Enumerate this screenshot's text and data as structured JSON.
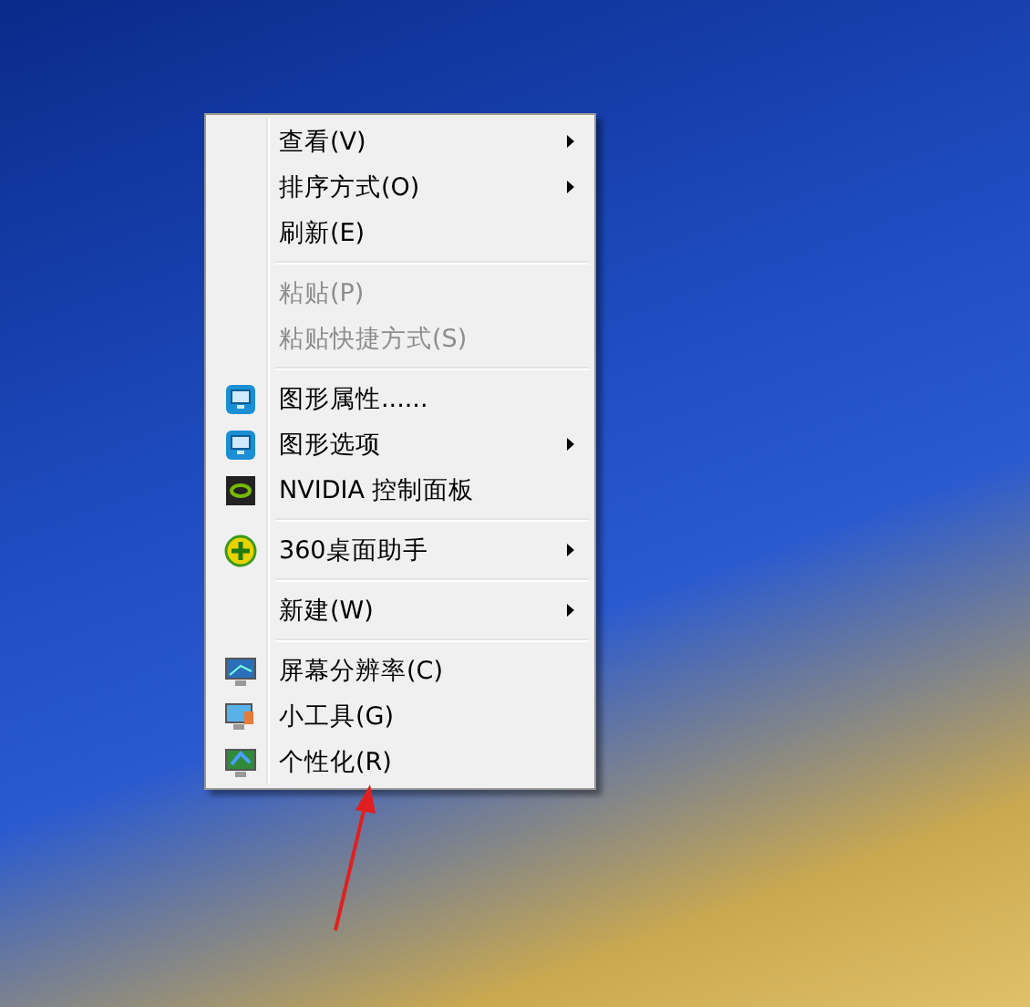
{
  "context_menu": {
    "groups": [
      [
        {
          "label": "查看(V)",
          "kind": "plain",
          "submenu": true,
          "disabled": false
        },
        {
          "label": "排序方式(O)",
          "kind": "plain",
          "submenu": true,
          "disabled": false
        },
        {
          "label": "刷新(E)",
          "kind": "plain",
          "submenu": false,
          "disabled": false
        }
      ],
      [
        {
          "label": "粘贴(P)",
          "kind": "plain",
          "submenu": false,
          "disabled": true
        },
        {
          "label": "粘贴快捷方式(S)",
          "kind": "plain",
          "submenu": false,
          "disabled": true
        }
      ],
      [
        {
          "label": "图形属性......",
          "kind": "graphics",
          "submenu": false,
          "disabled": false
        },
        {
          "label": "图形选项",
          "kind": "graphics",
          "submenu": true,
          "disabled": false
        },
        {
          "label": "NVIDIA 控制面板",
          "kind": "chip",
          "submenu": false,
          "disabled": false
        }
      ],
      [
        {
          "label": "360桌面助手",
          "kind": "plus",
          "submenu": true,
          "disabled": false
        }
      ],
      [
        {
          "label": "新建(W)",
          "kind": "plain",
          "submenu": true,
          "disabled": false
        }
      ],
      [
        {
          "label": "屏幕分辨率(C)",
          "kind": "monitor",
          "submenu": false,
          "disabled": false
        },
        {
          "label": "小工具(G)",
          "kind": "gadget",
          "submenu": false,
          "disabled": false
        },
        {
          "label": "个性化(R)",
          "kind": "personalize",
          "submenu": false,
          "disabled": false
        }
      ]
    ]
  }
}
